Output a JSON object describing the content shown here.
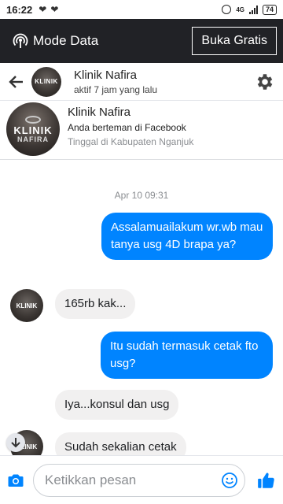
{
  "status_bar": {
    "time": "16:22",
    "network": "4G",
    "battery": "74"
  },
  "data_bar": {
    "label": "Mode Data",
    "button": "Buka Gratis"
  },
  "header": {
    "name": "Klinik Nafira",
    "status": "aktif 7 jam yang lalu"
  },
  "profile": {
    "name": "Klinik Nafira",
    "line1": "Anda berteman di Facebook",
    "line2": "Tinggal di Kabupaten Nganjuk",
    "logo_top": "KLINIK",
    "logo_bottom": "NAFIRA"
  },
  "chat": {
    "timestamp": "Apr 10 09:31",
    "messages": [
      {
        "from": "me",
        "text": "Assalamuailakum wr.wb mau tanya usg 4D brapa ya?"
      },
      {
        "from": "them",
        "text": "165rb kak..."
      },
      {
        "from": "me",
        "text": "Itu sudah termasuk cetak fto usg?"
      },
      {
        "from": "them",
        "text": "Iya...konsul dan usg"
      },
      {
        "from": "them",
        "text": "Sudah sekalian cetak"
      }
    ]
  },
  "composer": {
    "placeholder": "Ketikkan pesan"
  },
  "colors": {
    "accent": "#0084ff",
    "dark_bar": "#212226",
    "incoming_bubble": "#f1f0f0"
  }
}
